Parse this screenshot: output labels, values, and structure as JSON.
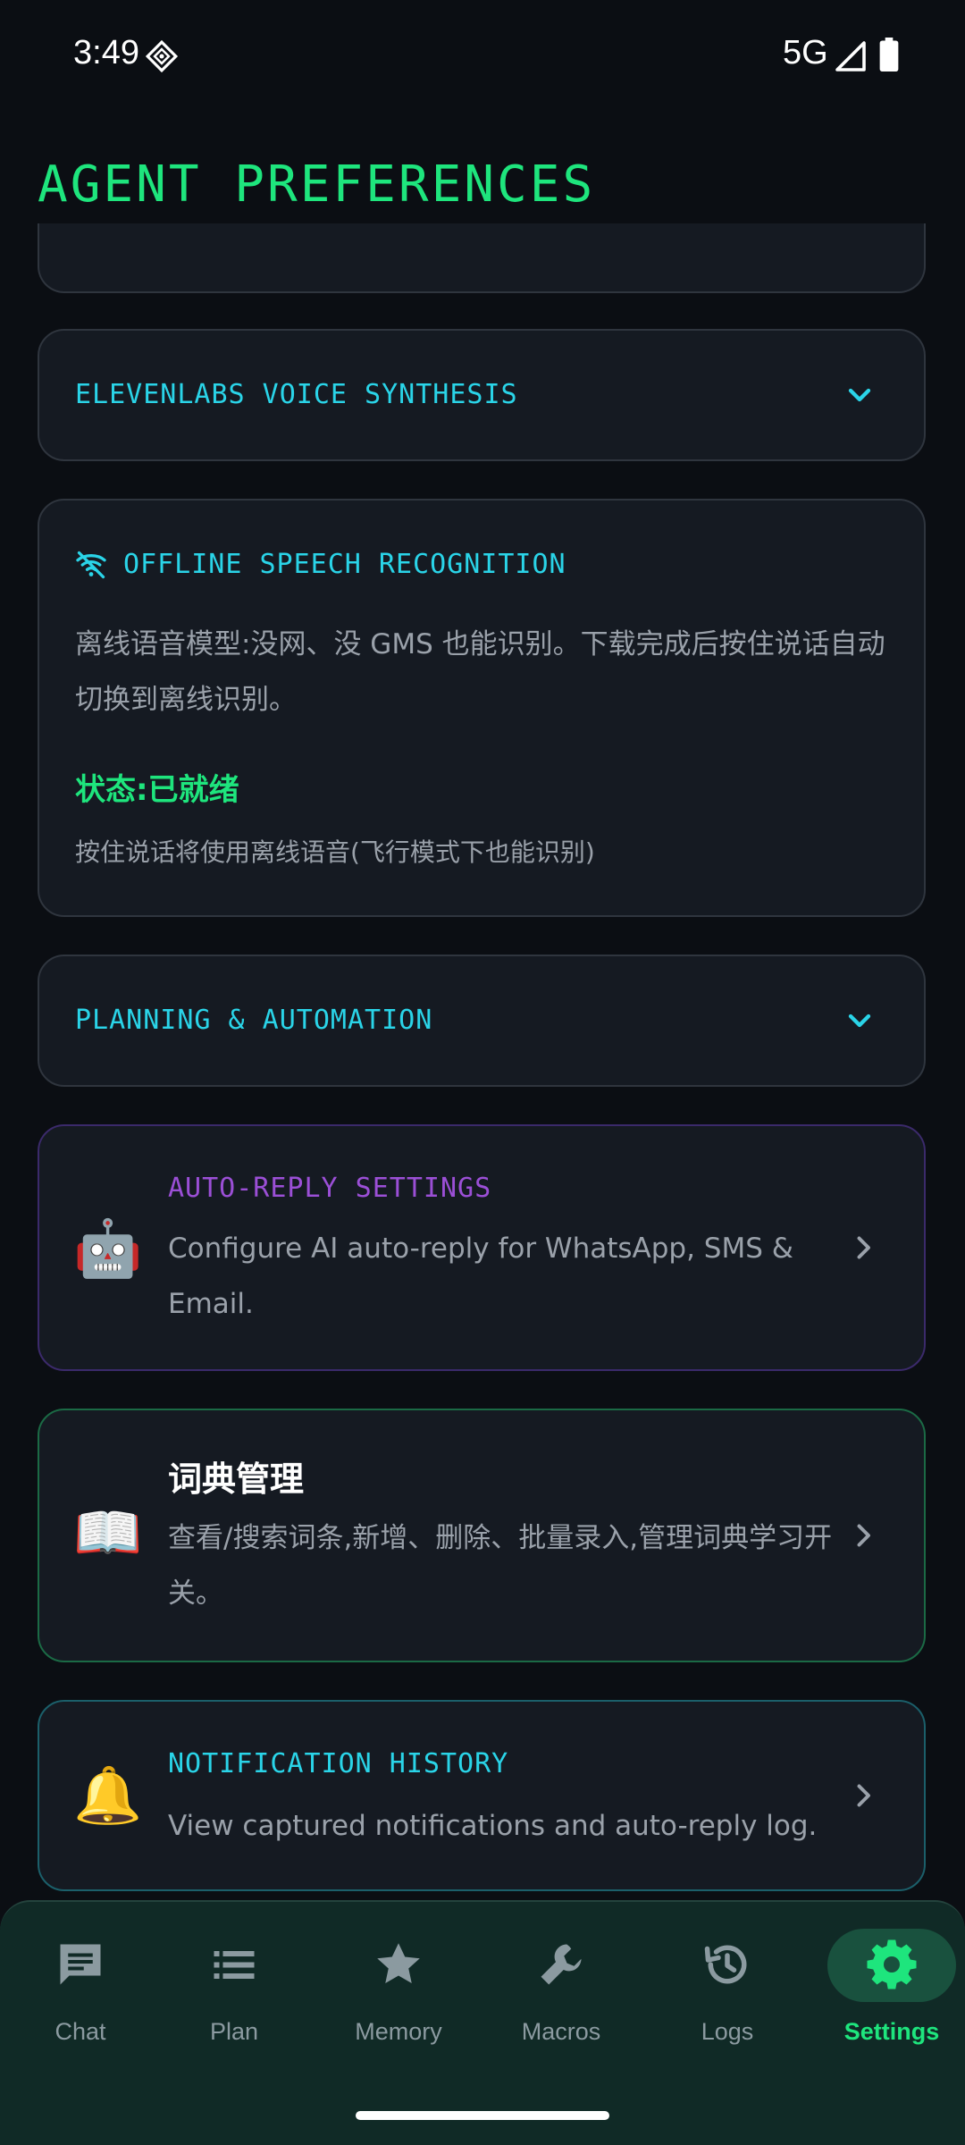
{
  "status_bar": {
    "time": "3:49",
    "network": "5G",
    "icons": [
      "diamond-sync-icon",
      "signal-icon",
      "battery-icon"
    ]
  },
  "page": {
    "title": "AGENT PREFERENCES"
  },
  "sections": {
    "voice": {
      "title": "ELEVENLABS VOICE SYNTHESIS",
      "icon": "chevron-down-icon"
    },
    "offline": {
      "title": "OFFLINE SPEECH RECOGNITION",
      "icon": "wifi-off-icon",
      "description": "离线语音模型:没网、没 GMS 也能识别。下载完成后按住说话自动切换到离线识别。",
      "status": "状态:已就绪",
      "hint": "按住说话将使用离线语音(飞行模式下也能识别)"
    },
    "planning": {
      "title": "PLANNING & AUTOMATION",
      "icon": "chevron-down-icon"
    }
  },
  "entries": {
    "autoreply": {
      "emoji": "🤖",
      "title": "AUTO-REPLY SETTINGS",
      "description": "Configure AI auto-reply for WhatsApp, SMS & Email."
    },
    "dictionary": {
      "emoji": "📖",
      "title": "词典管理",
      "description": "查看/搜索词条,新增、删除、批量录入,管理词典学习开关。"
    },
    "notifications": {
      "emoji": "🔔",
      "title": "NOTIFICATION HISTORY",
      "description": "View captured notifications and auto-reply log."
    }
  },
  "nav": {
    "items": [
      {
        "label": "Chat",
        "icon": "chat-icon"
      },
      {
        "label": "Plan",
        "icon": "list-icon"
      },
      {
        "label": "Memory",
        "icon": "star-icon"
      },
      {
        "label": "Macros",
        "icon": "wrench-icon"
      },
      {
        "label": "Logs",
        "icon": "history-icon"
      },
      {
        "label": "Settings",
        "icon": "gear-icon"
      }
    ],
    "active": "Settings"
  },
  "colors": {
    "background": "#0b0e13",
    "card": "#151a22",
    "accent_green": "#1ee57d",
    "accent_cyan": "#2ad4e8",
    "accent_purple": "#9b4fd6",
    "nav_background": "#102a26"
  }
}
